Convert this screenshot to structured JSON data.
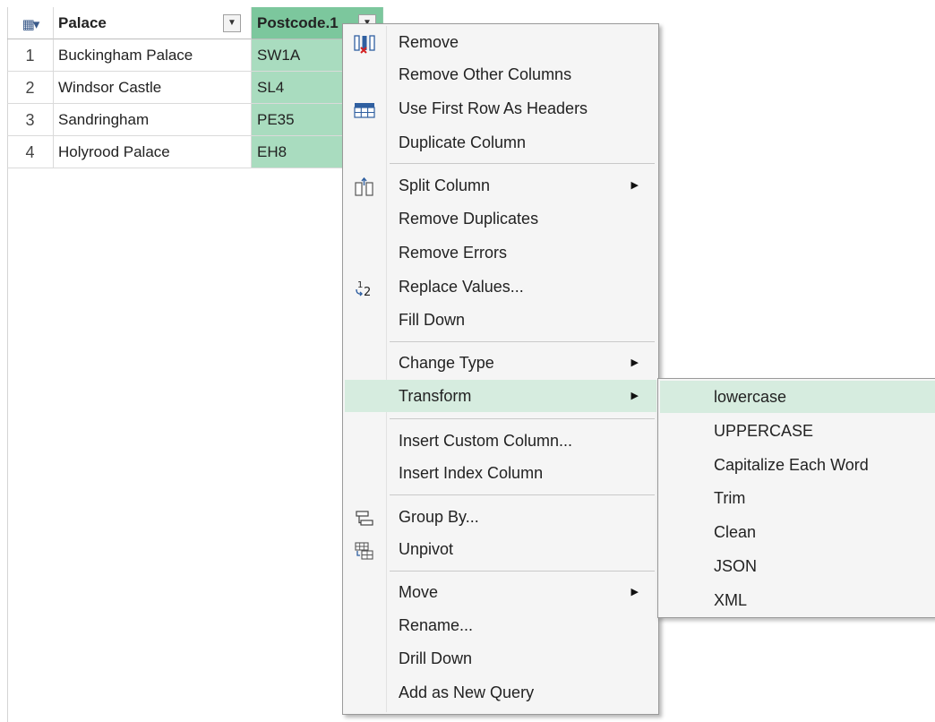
{
  "grid": {
    "corner_icon": "table-icon",
    "columns": [
      {
        "name": "Palace"
      },
      {
        "name": "Postcode.1"
      }
    ],
    "rows": [
      {
        "index": "1",
        "palace": "Buckingham Palace",
        "postcode": "SW1A"
      },
      {
        "index": "2",
        "palace": "Windsor Castle",
        "postcode": "SL4"
      },
      {
        "index": "3",
        "palace": "Sandringham",
        "postcode": "PE35"
      },
      {
        "index": "4",
        "palace": "Holyrood Palace",
        "postcode": "EH8"
      }
    ],
    "selected_column": "Postcode.1",
    "selected_column_color": "#a9dcbf"
  },
  "context_menu": {
    "items": [
      {
        "label": "Remove",
        "icon": "remove-column-icon"
      },
      {
        "label": "Remove Other Columns"
      },
      {
        "label": "Use First Row As Headers",
        "icon": "table-header-icon"
      },
      {
        "label": "Duplicate Column"
      },
      {
        "label": "Split Column",
        "icon": "split-column-icon",
        "submenu": true
      },
      {
        "label": "Remove Duplicates"
      },
      {
        "label": "Remove Errors"
      },
      {
        "label": "Replace Values...",
        "icon": "replace-values-icon"
      },
      {
        "label": "Fill Down"
      },
      {
        "label": "Change Type",
        "submenu": true
      },
      {
        "label": "Transform",
        "submenu": true,
        "highlighted": true
      },
      {
        "label": "Insert Custom Column..."
      },
      {
        "label": "Insert Index Column"
      },
      {
        "label": "Group By...",
        "icon": "group-by-icon"
      },
      {
        "label": "Unpivot",
        "icon": "unpivot-icon"
      },
      {
        "label": "Move",
        "submenu": true
      },
      {
        "label": "Rename..."
      },
      {
        "label": "Drill Down"
      },
      {
        "label": "Add as New Query"
      }
    ],
    "highlight_color": "#d6ecdf"
  },
  "transform_submenu": {
    "items": [
      {
        "label": "lowercase",
        "highlighted": true
      },
      {
        "label": "UPPERCASE"
      },
      {
        "label": "Capitalize Each Word"
      },
      {
        "label": "Trim"
      },
      {
        "label": "Clean"
      },
      {
        "label": "JSON"
      },
      {
        "label": "XML"
      }
    ]
  }
}
